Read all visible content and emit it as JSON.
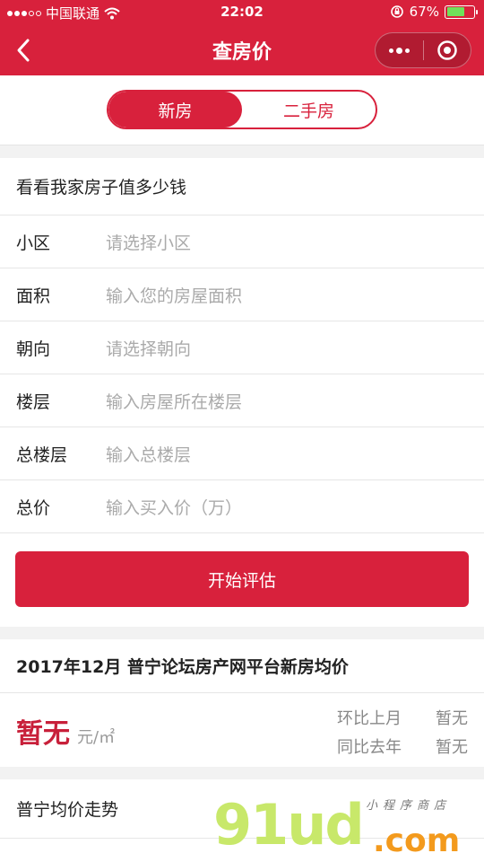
{
  "status_bar": {
    "carrier": "中国联通",
    "time": "22:02",
    "battery_percent": "67%",
    "battery_level": 0.67
  },
  "nav": {
    "title": "查房价"
  },
  "tabs": [
    {
      "label": "新房",
      "active": true
    },
    {
      "label": "二手房",
      "active": false
    }
  ],
  "form": {
    "title": "看看我家房子值多少钱",
    "fields": [
      {
        "label": "小区",
        "placeholder": "请选择小区"
      },
      {
        "label": "面积",
        "placeholder": "输入您的房屋面积"
      },
      {
        "label": "朝向",
        "placeholder": "请选择朝向"
      },
      {
        "label": "楼层",
        "placeholder": "输入房屋所在楼层"
      },
      {
        "label": "总楼层",
        "placeholder": "输入总楼层"
      },
      {
        "label": "总价",
        "placeholder": "输入买入价（万）"
      }
    ],
    "submit_label": "开始评估"
  },
  "price": {
    "title": "2017年12月  普宁论坛房产网平台新房均价",
    "value": "暂无",
    "unit": "元/㎡",
    "compare": [
      {
        "label": "环比上月",
        "value": "暂无"
      },
      {
        "label": "同比去年",
        "value": "暂无"
      }
    ]
  },
  "trend": {
    "title": "普宁均价走势"
  },
  "watermark": {
    "main": "91ud",
    "domain": ".com",
    "tagline": "小程序商店"
  },
  "colors": {
    "brand": "#d8213c",
    "price": "#c8203a"
  }
}
